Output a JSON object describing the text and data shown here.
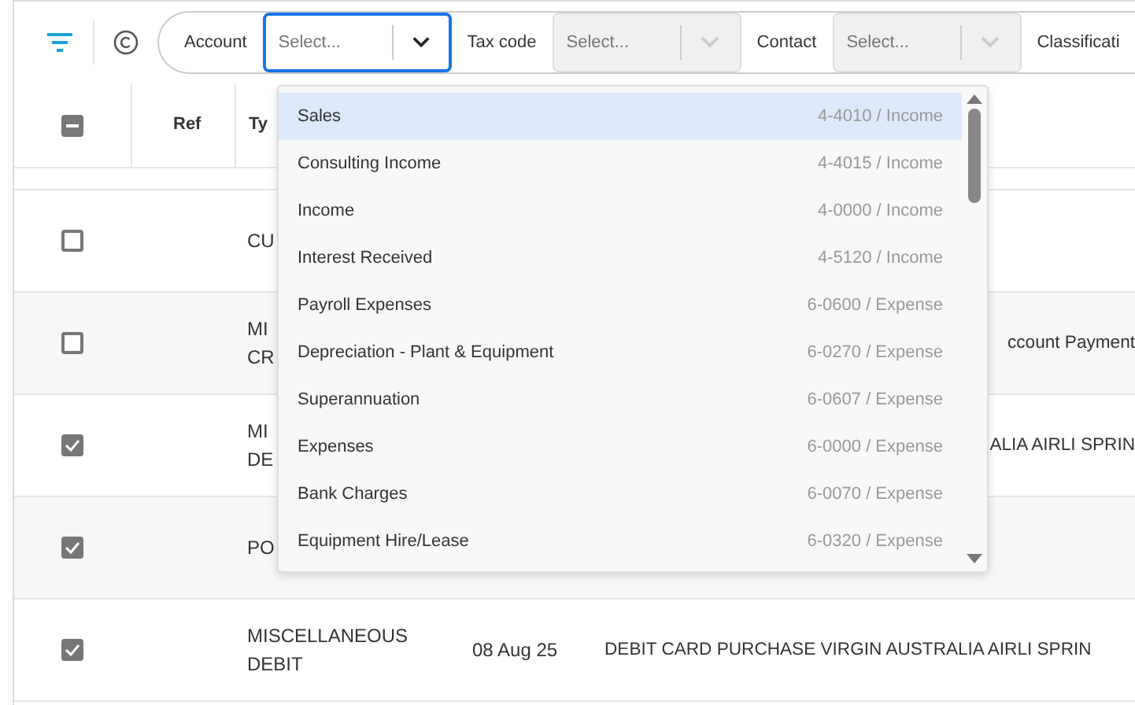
{
  "filter_bar": {
    "fields": [
      {
        "label": "Account",
        "placeholder": "Select...",
        "focused": true,
        "disabled": false
      },
      {
        "label": "Tax code",
        "placeholder": "Select...",
        "focused": false,
        "disabled": true
      },
      {
        "label": "Contact",
        "placeholder": "Select...",
        "focused": false,
        "disabled": true
      }
    ],
    "trailing_label": "Classificati"
  },
  "table": {
    "select_all": {
      "indeterminate": true
    },
    "columns": [
      "Ref",
      "Ty"
    ],
    "rows": [
      {
        "checked": false,
        "type": [
          "CU"
        ]
      },
      {
        "checked": false,
        "type": [
          "MI",
          "CR"
        ],
        "description": "ccount Payment",
        "covered": true
      },
      {
        "checked": true,
        "type": [
          "MI",
          "DE"
        ],
        "description": "ALIA AIRLI SPRIN",
        "covered": true
      },
      {
        "checked": true,
        "type": [
          "PO"
        ]
      },
      {
        "checked": true,
        "type": [
          "MISCELLANEOUS",
          "DEBIT"
        ],
        "date": "08 Aug 25",
        "description": "DEBIT CARD PURCHASE VIRGIN AUSTRALIA AIRLI SPRIN",
        "covered": false
      }
    ]
  },
  "dropdown": {
    "options": [
      {
        "name": "Sales",
        "code": "4-4010 / Income",
        "selected": true
      },
      {
        "name": "Consulting Income",
        "code": "4-4015 / Income",
        "selected": false
      },
      {
        "name": "Income",
        "code": "4-0000 / Income",
        "selected": false
      },
      {
        "name": "Interest Received",
        "code": "4-5120 / Income",
        "selected": false
      },
      {
        "name": "Payroll Expenses",
        "code": "6-0600 / Expense",
        "selected": false
      },
      {
        "name": "Depreciation - Plant & Equipment",
        "code": "6-0270 / Expense",
        "selected": false
      },
      {
        "name": "Superannuation",
        "code": "6-0607 / Expense",
        "selected": false
      },
      {
        "name": "Expenses",
        "code": "6-0000 / Expense",
        "selected": false
      },
      {
        "name": "Bank Charges",
        "code": "6-0070 / Expense",
        "selected": false
      },
      {
        "name": "Equipment Hire/Lease",
        "code": "6-0320 / Expense",
        "selected": false
      }
    ]
  }
}
